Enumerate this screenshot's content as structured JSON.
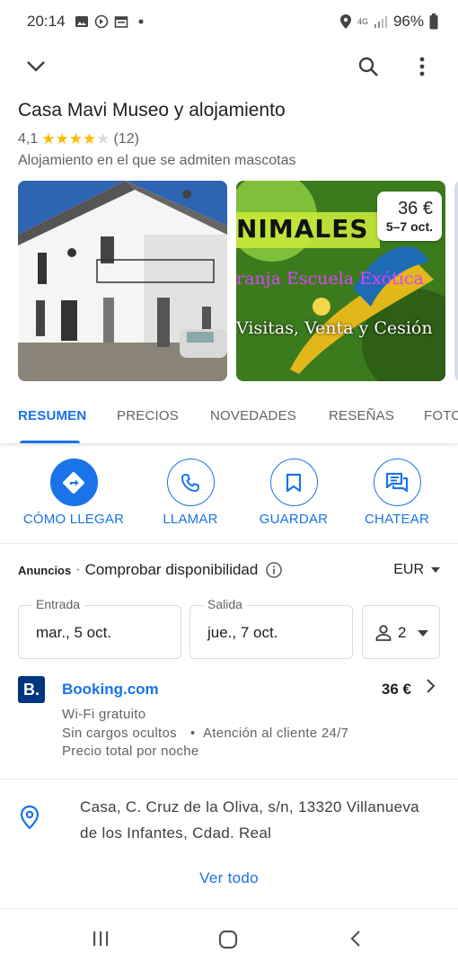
{
  "status": {
    "time": "20:14",
    "network": "4G",
    "battery": "96%"
  },
  "place": {
    "name": "Casa Mavi Museo y alojamiento",
    "rating": "4,1",
    "rating_value": 4.1,
    "review_count": "(12)",
    "category": "Alojamiento en el que se admiten mascotas"
  },
  "photos": {
    "photo2_lines": [
      "NIMALES",
      "ranja Escuela Exótica",
      "Visitas, Venta y Cesión"
    ],
    "price": "36 €",
    "dates": "5–7 oct."
  },
  "tabs": [
    "RESUMEN",
    "PRECIOS",
    "NOVEDADES",
    "RESEÑAS",
    "FOTO"
  ],
  "actions": [
    "CÓMO LLEGAR",
    "LLAMAR",
    "GUARDAR",
    "CHATEAR"
  ],
  "availability": {
    "ads": "Anuncios",
    "check": "Comprobar disponibilidad",
    "currency": "EUR",
    "checkin_label": "Entrada",
    "checkin_value": "mar., 5 oct.",
    "checkout_label": "Salida",
    "checkout_value": "jue., 7 oct.",
    "guests": "2"
  },
  "booking": {
    "logo": "B.",
    "name": "Booking.com",
    "price": "36 €",
    "amenity1": "Wi-Fi gratuito",
    "amenity2": "Sin cargos ocultos",
    "amenity3": "Atención al cliente 24/7",
    "note": "Precio total por noche"
  },
  "address": "Casa, C. Cruz de la Oliva, s/n, 13320 Villanueva de los Infantes, Cdad. Real",
  "see_all": "Ver todo",
  "colors": {
    "accent": "#1a73e8",
    "star": "#fbbc04",
    "booking_brand": "#003580"
  }
}
